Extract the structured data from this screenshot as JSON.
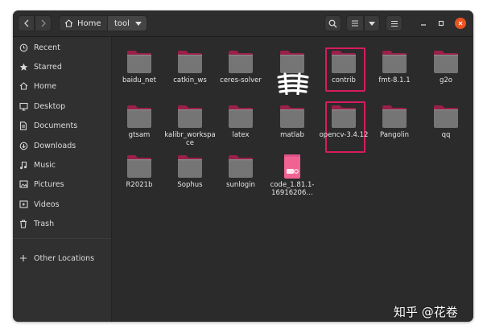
{
  "headerbar": {
    "back_icon": "chevron-left-icon",
    "forward_icon": "chevron-right-icon",
    "path": [
      {
        "label": "Home",
        "icon": "home-icon"
      },
      {
        "label": "tool",
        "icon": "caret-down-icon"
      }
    ],
    "search_icon": "search-icon",
    "view_icon": "list-view-icon",
    "sort_icon": "caret-down-icon",
    "menu_icon": "hamburger-icon",
    "window_controls": [
      "minimize-icon",
      "maximize-icon",
      "close-icon"
    ],
    "close_color": "#e95420"
  },
  "sidebar": {
    "items": [
      {
        "label": "Recent",
        "icon": "clock-icon"
      },
      {
        "label": "Starred",
        "icon": "star-icon"
      },
      {
        "label": "Home",
        "icon": "home-icon"
      },
      {
        "label": "Desktop",
        "icon": "desktop-icon"
      },
      {
        "label": "Documents",
        "icon": "documents-icon"
      },
      {
        "label": "Downloads",
        "icon": "download-icon"
      },
      {
        "label": "Music",
        "icon": "music-icon"
      },
      {
        "label": "Pictures",
        "icon": "pictures-icon"
      },
      {
        "label": "Videos",
        "icon": "videos-icon"
      },
      {
        "label": "Trash",
        "icon": "trash-icon"
      }
    ],
    "other": {
      "label": "Other Locations",
      "icon": "plus-icon"
    }
  },
  "files": [
    {
      "name": "baidu_net",
      "type": "folder"
    },
    {
      "name": "catkin_ws",
      "type": "folder"
    },
    {
      "name": "ceres-solver",
      "type": "folder"
    },
    {
      "name": "",
      "type": "folder"
    },
    {
      "name": "contrib",
      "type": "folder"
    },
    {
      "name": "fmt-8.1.1",
      "type": "folder"
    },
    {
      "name": "g2o",
      "type": "folder"
    },
    {
      "name": "gtsam",
      "type": "folder"
    },
    {
      "name": "kalibr_workspace",
      "type": "folder"
    },
    {
      "name": "latex",
      "type": "folder"
    },
    {
      "name": "matlab",
      "type": "folder"
    },
    {
      "name": "opencv-3.4.12",
      "type": "folder"
    },
    {
      "name": "Pangolin",
      "type": "folder"
    },
    {
      "name": "qq",
      "type": "folder"
    },
    {
      "name": "R2021b",
      "type": "folder"
    },
    {
      "name": "Sophus",
      "type": "folder"
    },
    {
      "name": "sunlogin",
      "type": "folder"
    },
    {
      "name": "code_1.81.1-16916206…",
      "type": "deb-package"
    }
  ],
  "colors": {
    "folder_body": "#757575",
    "folder_tab": "#9b1f4b",
    "highlight": "#d81b60",
    "package": "#f06292"
  },
  "watermark": "知乎 @花卷"
}
